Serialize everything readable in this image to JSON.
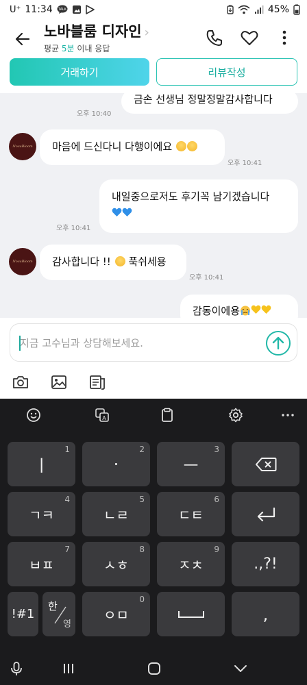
{
  "status": {
    "carrier": "U⁺",
    "time": "11:34",
    "battery": "45%",
    "icons": [
      "talk-icon",
      "gallery-icon",
      "play-store-icon",
      "battery-saver-icon",
      "wifi-icon",
      "signal-icon"
    ]
  },
  "header": {
    "title": "노바블룸 디자인",
    "subtitle_prefix": "평균 ",
    "subtitle_highlight": "5분",
    "subtitle_suffix": " 이내 응답"
  },
  "actions": {
    "deal_label": "거래하기",
    "review_label": "리뷰작성"
  },
  "messages": [
    {
      "side": "right",
      "text": "금손 선생님 정말정말감사합니다",
      "time": "오후 10:40"
    },
    {
      "side": "left",
      "text": "마음에 드신다니 다행이에요",
      "emoji": [
        "pleading",
        "pleading"
      ],
      "time": "오후 10:41"
    },
    {
      "side": "right",
      "text": "내일중으로저도 후기꼭 남기겠습니다",
      "emoji": [
        "blue-heart",
        "blue-heart"
      ],
      "time": "오후 10:41"
    },
    {
      "side": "left",
      "text_before": "감사합니다 !! ",
      "text_after": " 푹쉬세용",
      "emoji": [
        "pleading"
      ],
      "time": "오후 10:41"
    },
    {
      "side": "right",
      "text": "감동이에용",
      "emoji": [
        "crying",
        "yellow-heart",
        "yellow-heart"
      ]
    }
  ],
  "avatar_text": "NovaBloom",
  "input": {
    "placeholder": "지금 고수님과 상담해보세요."
  },
  "keyboard": {
    "rows": [
      [
        {
          "label": "ㅣ",
          "num": "1"
        },
        {
          "label": "·",
          "num": "2"
        },
        {
          "label": "ㅡ",
          "num": "3"
        },
        {
          "label": "⌫",
          "num": ""
        }
      ],
      [
        {
          "label": "ㄱㅋ",
          "num": "4"
        },
        {
          "label": "ㄴㄹ",
          "num": "5"
        },
        {
          "label": "ㄷㅌ",
          "num": "6"
        },
        {
          "label": "↵",
          "num": ""
        }
      ],
      [
        {
          "label": "ㅂㅍ",
          "num": "7"
        },
        {
          "label": "ㅅㅎ",
          "num": "8"
        },
        {
          "label": "ㅈㅊ",
          "num": "9"
        },
        {
          "label": ".,?!",
          "num": ""
        }
      ],
      [
        {
          "label": "!#1",
          "num": ""
        },
        {
          "label": "한/영",
          "num": ""
        },
        {
          "label": "ㅇㅁ",
          "num": "0"
        },
        {
          "label": "␣",
          "num": ""
        },
        {
          "label": ",",
          "num": ""
        }
      ]
    ],
    "lang_top": "한",
    "lang_bottom": "영"
  }
}
